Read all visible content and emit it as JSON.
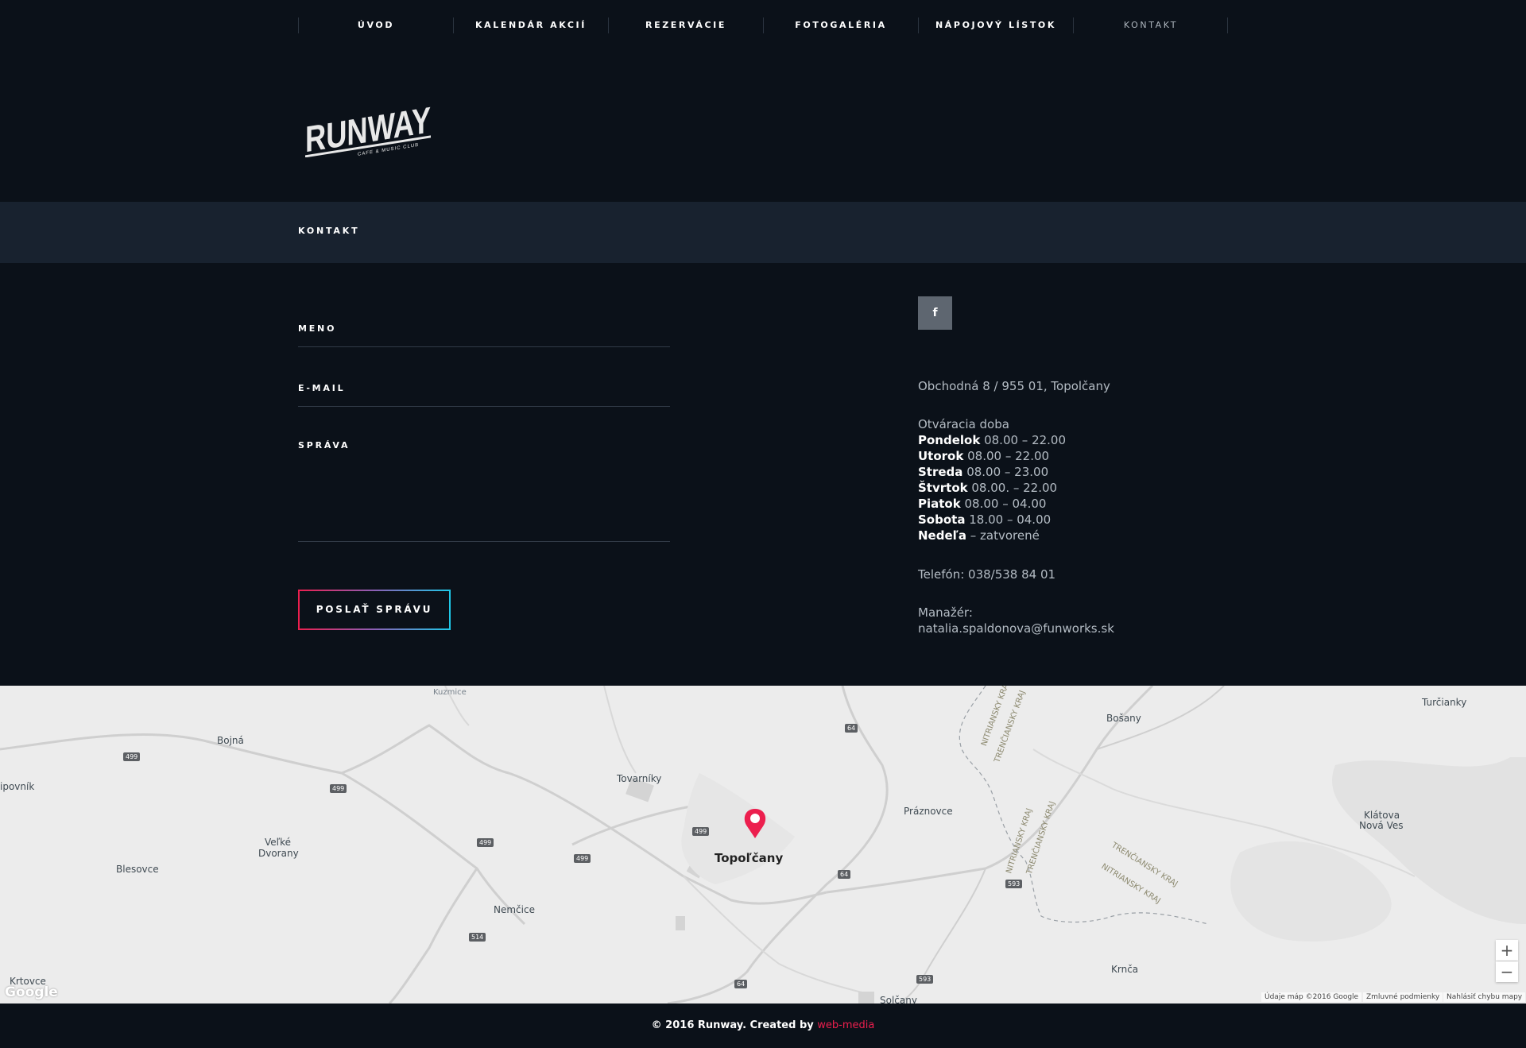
{
  "nav": {
    "items": [
      {
        "label": "ÚVOD"
      },
      {
        "label": "KALENDÁR AKCIÍ"
      },
      {
        "label": "REZERVÁCIE"
      },
      {
        "label": "FOTOGALÉRIA"
      },
      {
        "label": "NÁPOJOVÝ LÍSTOK"
      },
      {
        "label": "KONTAKT"
      }
    ],
    "active_index": 5
  },
  "logo": {
    "text": "RUNWAY",
    "subtext": "CAFE & MUSIC CLUB"
  },
  "page_title": "KONTAKT",
  "form": {
    "name_label": "MENO",
    "email_label": "E-MAIL",
    "message_label": "SPRÁVA",
    "submit_label": "POSLAŤ SPRÁVU"
  },
  "social": {
    "facebook_icon": "f"
  },
  "contact": {
    "address": "Obchodná 8 / 955 01, Topolčany",
    "hours_title": "Otváracia doba",
    "hours": [
      {
        "day": "Pondelok",
        "time": "08.00 – 22.00"
      },
      {
        "day": "Utorok",
        "time": "08.00 – 22.00"
      },
      {
        "day": "Streda",
        "time": "08.00 – 23.00"
      },
      {
        "day": "Štvrtok",
        "time": "08.00. – 22.00"
      },
      {
        "day": "Piatok",
        "time": "08.00 – 04.00"
      },
      {
        "day": "Sobota",
        "time": "18.00 – 04.00"
      },
      {
        "day": "Nedeľa",
        "time": "– zatvorené"
      }
    ],
    "phone": "Telefón: 038/538 84 01",
    "manager_label": "Manažér:",
    "manager_email": "natalia.spaldonova@funworks.sk"
  },
  "map": {
    "places": {
      "kuzmice": "Kuzmice",
      "bojna": "Bojná",
      "lipovnik": "ipovník",
      "velke": "Veľké",
      "dvorany": "Dvorany",
      "blesovce": "Blesovce",
      "tovarniky": "Tovarníky",
      "topolcany": "Topoľčany",
      "nemcice": "Nemčice",
      "krtovce": "Krtovce",
      "praznovce": "Práznovce",
      "bosany": "Bošany",
      "turcianky": "Turčianky",
      "klatova": "Klátova",
      "nova_ves": "Nová Ves",
      "krnca": "Krnča",
      "solcany": "Solčany"
    },
    "roads": {
      "r499a": "499",
      "r499b": "499",
      "r499c": "499",
      "r499d": "499",
      "r499e": "499",
      "r64a": "64",
      "r64b": "64",
      "r64c": "64",
      "r514": "514",
      "r593a": "593",
      "r593b": "593"
    },
    "regions": {
      "nitriansky1": "NITRIANSKY KRAJ",
      "trenciansky1": "TRENČIANSKY KRAJ",
      "nitriansky2": "NITRIANSKY KRAJ",
      "trenciansky2": "TRENČIANSKY KRAJ",
      "nitriansky3": "NITRIANSKY KRAJ",
      "trenciansky3": "TRENČIANSKY KRAJ"
    },
    "zoom_in": "+",
    "zoom_out": "−",
    "google": "Google",
    "footer": {
      "data": "Údaje máp ©2016 Google",
      "terms": "Zmluvné podmienky",
      "report": "Nahlásiť chybu mapy"
    }
  },
  "footer": {
    "text": "© 2016 Runway. Created by",
    "link": "web-media"
  }
}
